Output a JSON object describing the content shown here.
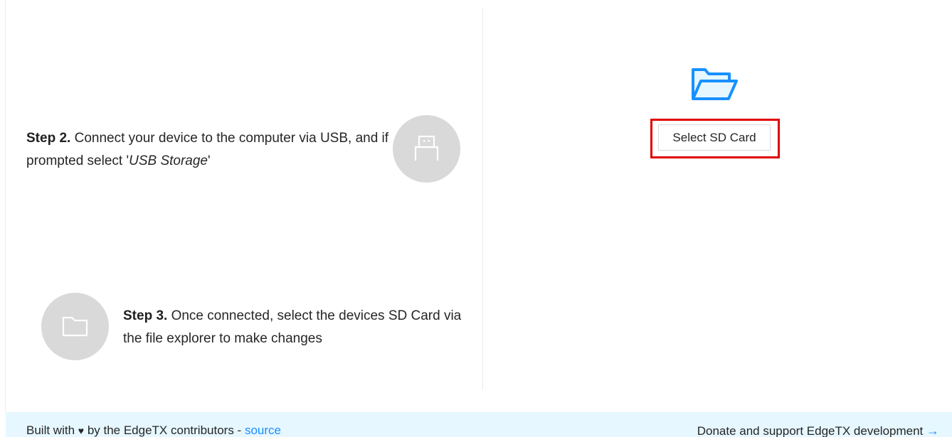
{
  "steps": {
    "step2": {
      "heading": "Step 2.",
      "text_before": " Connect your device to the computer via USB, and if prompted select '",
      "emphasis": "USB Storage",
      "text_after": "'",
      "icon": "usb-icon"
    },
    "step3": {
      "heading": "Step 3.",
      "text": " Once connected, select the devices SD Card via the file explorer to make changes",
      "icon": "folder-icon"
    }
  },
  "action": {
    "icon": "folder-open-icon",
    "select_button_label": "Select SD Card",
    "highlight_color": "#e00000"
  },
  "footer": {
    "built_prefix": "Built with",
    "heart": "♥",
    "built_suffix": "by the EdgeTX contributors -",
    "source_link": "source",
    "donate_text": "Donate and support EdgeTX development",
    "arrow": "→"
  },
  "colors": {
    "accent": "#1890ff",
    "footer_bg": "#e6f7ff",
    "circle_bg": "#d9d9d9",
    "folder_fill": "#e6f7ff"
  }
}
